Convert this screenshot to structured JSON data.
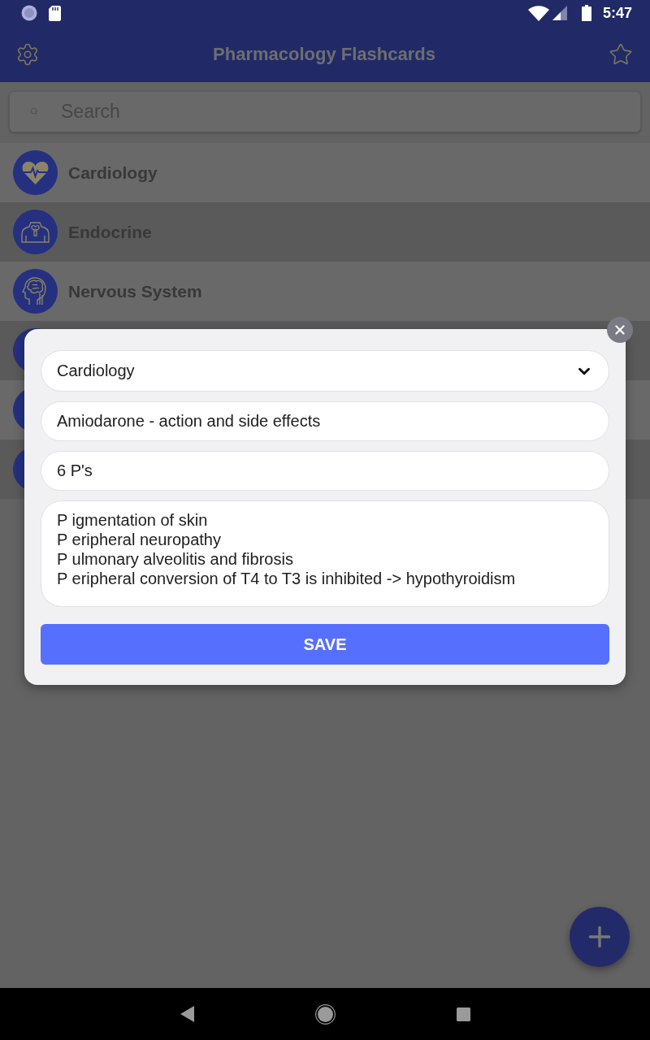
{
  "status_bar": {
    "time": "5:47"
  },
  "app_bar": {
    "title": "Pharmacology Flashcards"
  },
  "search": {
    "placeholder": "Search"
  },
  "categories": [
    {
      "label": "Cardiology"
    },
    {
      "label": "Endocrine"
    },
    {
      "label": "Nervous System"
    }
  ],
  "dialog": {
    "category": {
      "value": "Cardiology"
    },
    "question": {
      "value": "Amiodarone - action and side effects"
    },
    "hint": {
      "value": "6 P's"
    },
    "answer": {
      "lines": [
        "P igmentation of skin",
        "P eripheral neuropathy",
        "P ulmonary alveolitis and fibrosis",
        "P eripheral conversion of T4 to T3 is inhibited -> hypothyroidism"
      ]
    },
    "save_button": "SAVE"
  }
}
